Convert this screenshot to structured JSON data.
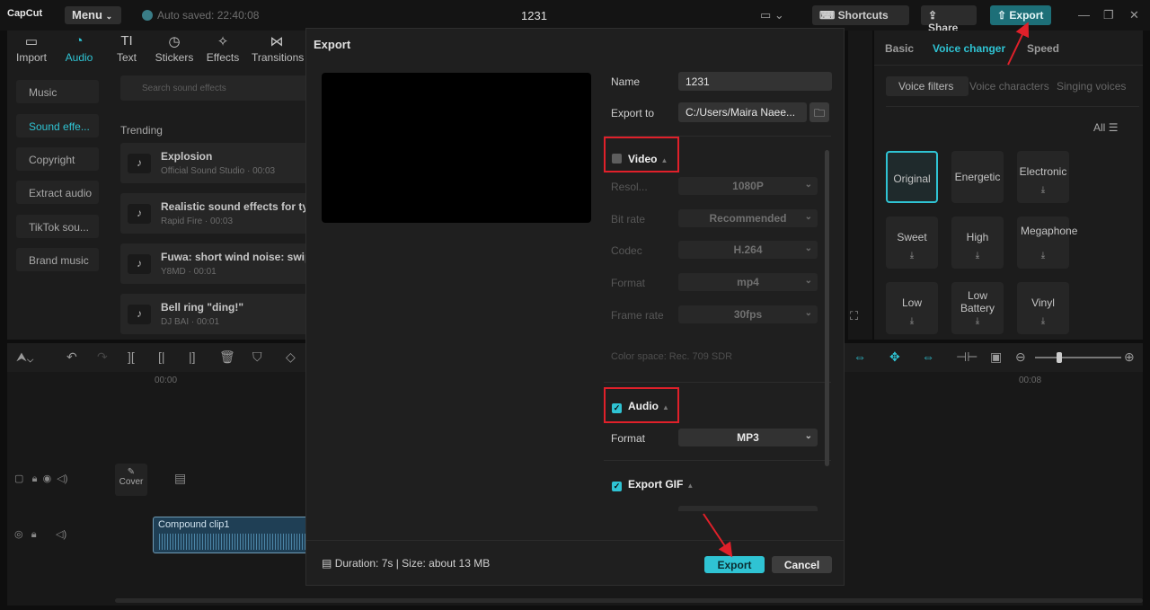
{
  "titlebar": {
    "logo": "CapCut",
    "menu_label": "Menu",
    "autosave": "Auto saved: 22:40:08",
    "project_title": "1231",
    "shortcuts_label": "Shortcuts",
    "share_label": "Share",
    "export_label": "Export"
  },
  "left_panel": {
    "toolbar": [
      {
        "label": "Import",
        "icon": "import-icon"
      },
      {
        "label": "Audio",
        "icon": "audio-icon"
      },
      {
        "label": "Text",
        "icon": "text-icon"
      },
      {
        "label": "Stickers",
        "icon": "stickers-icon"
      },
      {
        "label": "Effects",
        "icon": "effects-icon"
      },
      {
        "label": "Transitions",
        "icon": "transitions-icon"
      }
    ],
    "categories": [
      "Music",
      "Sound effe...",
      "Copyright",
      "Extract audio",
      "TikTok sou...",
      "Brand music"
    ],
    "search_placeholder": "Search sound effects",
    "trending_label": "Trending",
    "sounds": [
      {
        "title": "Explosion",
        "sub": "Official Sound Studio · 00:03"
      },
      {
        "title": "Realistic sound effects for ty",
        "sub": "Rapid Fire · 00:03"
      },
      {
        "title": "Fuwa: short wind noise: swip",
        "sub": "Y8MD · 00:01"
      },
      {
        "title": "Bell ring \"ding!\"",
        "sub": "DJ BAI · 00:01"
      }
    ]
  },
  "right_panel": {
    "tabs": [
      "Basic",
      "Voice changer",
      "Speed"
    ],
    "subtabs": [
      "Voice filters",
      "Voice characters",
      "Singing voices"
    ],
    "all_label": "All",
    "voices": [
      "Original",
      "Energetic",
      "Electronic",
      "Sweet",
      "High",
      "Megaphone",
      "Low",
      "Low Battery",
      "Vinyl"
    ]
  },
  "timeline": {
    "ruler": [
      "00:00",
      "00:08"
    ],
    "cover_label": "Cover",
    "clip_label": "Compound clip1"
  },
  "export_dialog": {
    "title": "Export",
    "name_label": "Name",
    "name_value": "1231",
    "export_to_label": "Export to",
    "export_to_value": "C:/Users/Maira Naee...",
    "video_section": "Video",
    "video_rows": [
      {
        "label": "Resol...",
        "value": "1080P"
      },
      {
        "label": "Bit rate",
        "value": "Recommended"
      },
      {
        "label": "Codec",
        "value": "H.264"
      },
      {
        "label": "Format",
        "value": "mp4"
      },
      {
        "label": "Frame rate",
        "value": "30fps"
      }
    ],
    "color_space": "Color space: Rec. 709 SDR",
    "audio_section": "Audio",
    "audio_format_label": "Format",
    "audio_format_value": "MP3",
    "gif_section": "Export GIF",
    "duration_text": "Duration: 7s | Size: about 13 MB",
    "export_button": "Export",
    "cancel_button": "Cancel",
    "video_checked": false,
    "audio_checked": true,
    "gif_checked": true
  },
  "colors": {
    "accent": "#2fc3d3",
    "highlight": "#e0202a"
  }
}
